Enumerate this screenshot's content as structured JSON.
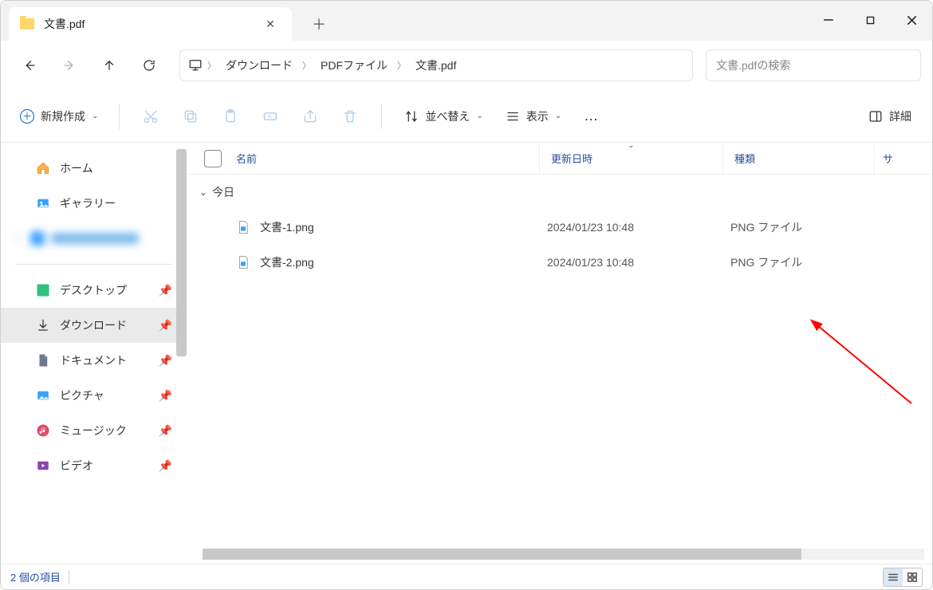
{
  "window": {
    "tab_title": "文書.pdf",
    "minimize": "—",
    "maximize": "☐",
    "close": "✕",
    "tab_close": "✕",
    "tab_add": "＋"
  },
  "path": {
    "pc_icon": "🖥",
    "segs": [
      "ダウンロード",
      "PDFファイル",
      "文書.pdf"
    ]
  },
  "search": {
    "placeholder": "文書.pdfの検索"
  },
  "toolbar": {
    "new_label": "新規作成",
    "sort_label": "並べ替え",
    "view_label": "表示",
    "details_label": "詳細",
    "icons": {
      "cut": "cut-icon",
      "copy": "copy-icon",
      "paste": "paste-icon",
      "rename": "rename-icon",
      "share": "share-icon",
      "delete": "delete-icon",
      "more": "…"
    }
  },
  "sidebar": {
    "home": "ホーム",
    "gallery": "ギャラリー",
    "hidden": "█████ ████",
    "desktop": "デスクトップ",
    "downloads": "ダウンロード",
    "documents": "ドキュメント",
    "pictures": "ピクチャ",
    "music": "ミュージック",
    "videos": "ビデオ"
  },
  "columns": {
    "name": "名前",
    "date": "更新日時",
    "type": "種類",
    "size": "サ"
  },
  "group": {
    "today": "今日"
  },
  "files": [
    {
      "name": "文書-1.png",
      "date": "2024/01/23 10:48",
      "type": "PNG ファイル"
    },
    {
      "name": "文書-2.png",
      "date": "2024/01/23 10:48",
      "type": "PNG ファイル"
    }
  ],
  "status": {
    "count_label": "2 個の項目"
  }
}
